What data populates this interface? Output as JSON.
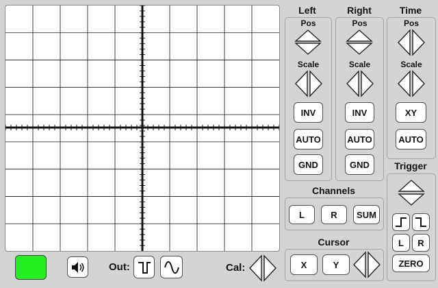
{
  "colors": {
    "background": "#d4d4d4",
    "screen": "#ffffff",
    "indicator": "#22ee22"
  },
  "channels": {
    "left": {
      "title": "Left",
      "pos_label": "Pos",
      "scale_label": "Scale",
      "buttons": [
        "INV",
        "AUTO",
        "GND"
      ]
    },
    "right": {
      "title": "Right",
      "pos_label": "Pos",
      "scale_label": "Scale",
      "buttons": [
        "INV",
        "AUTO",
        "GND"
      ]
    },
    "time": {
      "title": "Time",
      "pos_label": "Pos",
      "scale_label": "Scale",
      "buttons": [
        "XY",
        "AUTO"
      ]
    }
  },
  "channels_group": {
    "title": "Channels",
    "buttons": [
      "L",
      "R",
      "SUM"
    ]
  },
  "cursor_group": {
    "title": "Cursor",
    "buttons": [
      "X",
      "Y"
    ]
  },
  "trigger": {
    "title": "Trigger",
    "buttons": [
      "L",
      "R",
      "ZERO"
    ],
    "edge_icons": [
      "rising-edge-icon",
      "falling-edge-icon"
    ]
  },
  "bottom": {
    "out_label": "Out:",
    "cal_label": "Cal:",
    "icons": [
      "speaker-icon",
      "square-wave-icon",
      "sine-wave-icon"
    ]
  }
}
